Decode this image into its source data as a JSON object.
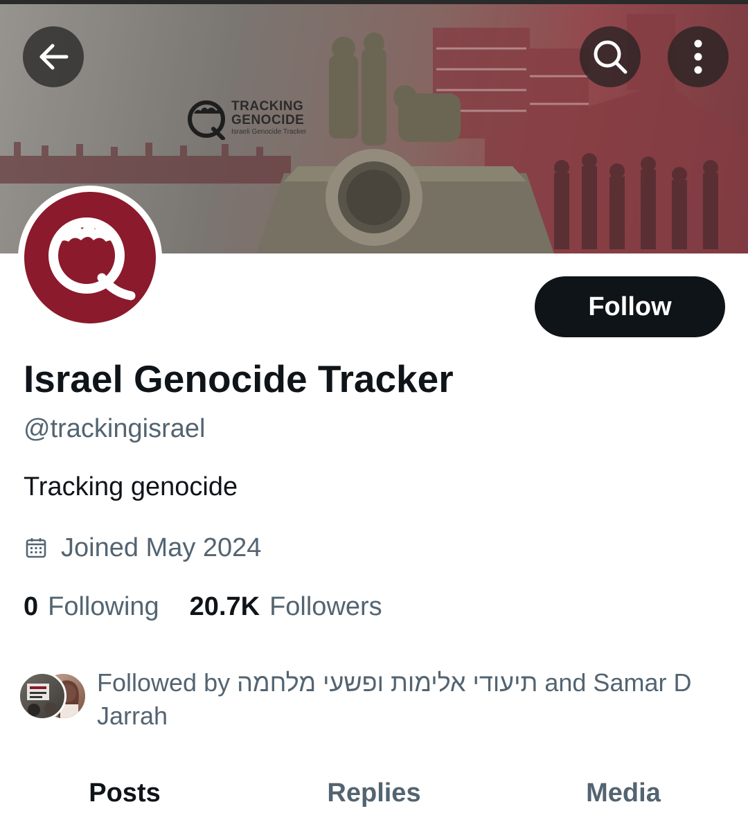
{
  "header": {
    "back_icon": "arrow-left-icon",
    "search_icon": "search-icon",
    "more_icon": "more-vertical-icon",
    "banner_logo": {
      "line1": "TRACKING",
      "line2": "GENOCIDE",
      "line3": "Israeli Genocide Tracker"
    }
  },
  "profile": {
    "display_name": "Israel Genocide Tracker",
    "handle": "@trackingisrael",
    "bio": "Tracking genocide",
    "joined_icon": "calendar-icon",
    "joined": "Joined May 2024",
    "follow_label": "Follow",
    "following_count": "0",
    "following_label": "Following",
    "followers_count": "20.7K",
    "followers_label": "Followers",
    "followed_by": "Followed by תיעודי אלימות ופשעי מלחמה and Samar D Jarrah"
  },
  "tabs": [
    {
      "label": "Posts",
      "active": true
    },
    {
      "label": "Replies",
      "active": false
    },
    {
      "label": "Media",
      "active": false
    }
  ],
  "colors": {
    "brand": "#8b1a2c",
    "text_primary": "#0f1419",
    "text_secondary": "#536471",
    "button_bg": "#0f1419"
  }
}
